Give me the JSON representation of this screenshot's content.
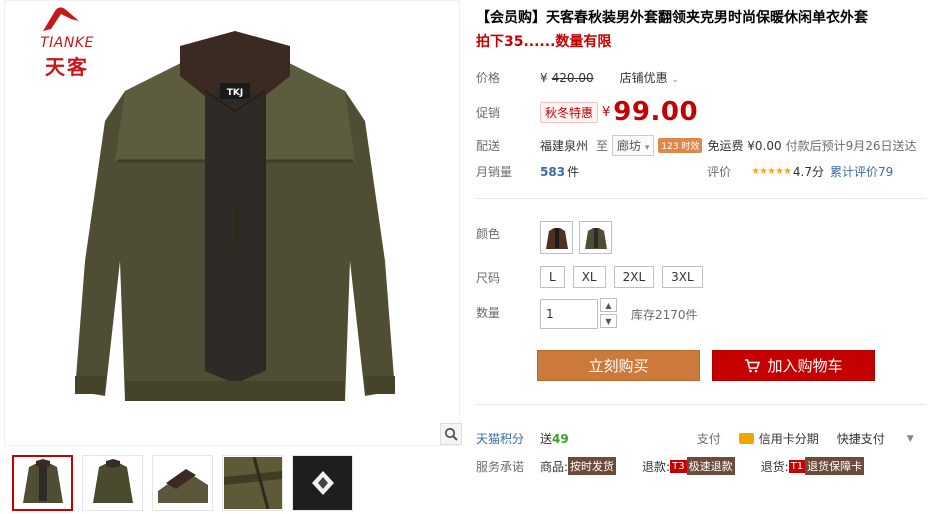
{
  "brand": {
    "name_en": "TIANKE",
    "name_cn": "天客"
  },
  "product": {
    "title": "【会员购】天客春秋装男外套翻领夹克男时尚保暖休闲单衣外套",
    "subtitle": "拍下35......数量有限",
    "label_tag": "TKJ"
  },
  "price": {
    "label": "价格",
    "currency": "¥",
    "original": "420.00",
    "shop_promo": "店铺优惠"
  },
  "promo": {
    "label": "促销",
    "tag": "秋冬特惠",
    "currency": "¥",
    "value": "99.00"
  },
  "shipping": {
    "label": "配送",
    "origin": "福建泉州",
    "to": "至",
    "destination": "廊坊",
    "hours_badge": "123 时效",
    "fee": "免运费 ¥0.00",
    "estimate": "付款后预计9月26日送达"
  },
  "sales": {
    "label": "月销量",
    "count": "583",
    "unit": "件",
    "rating_label": "评价",
    "stars": "★★★★★",
    "score": "4.7分",
    "reviews": "累计评价79"
  },
  "options": {
    "color_label": "颜色",
    "size_label": "尺码",
    "sizes": [
      "L",
      "XL",
      "2XL",
      "3XL"
    ],
    "qty_label": "数量",
    "qty_value": "1",
    "stock": "库存2170件"
  },
  "actions": {
    "buy_now": "立刻购买",
    "add_cart": "加入购物车"
  },
  "points": {
    "label": "天猫积分",
    "value_prefix": "送",
    "value": "49",
    "pay_label": "支付",
    "card": "信用卡分期",
    "quick_pay": "快捷支付"
  },
  "service": {
    "label": "服务承诺",
    "goods_label": "商品:",
    "goods_tag": "按时发货",
    "refund_label": "退款:",
    "refund_badge": "T3",
    "refund_tag": "极速退款",
    "return_label": "退货:",
    "return_badge": "T1",
    "return_tag": "退货保障卡"
  },
  "colors": {
    "accent": "#c40000",
    "buy_now": "#cc7a3c",
    "jacket": "#4f4d33",
    "collar": "#3b2a21"
  },
  "icons": [
    "zoom-icon",
    "cart-icon",
    "card-icon",
    "chevron-down-icon",
    "up-arrow-icon",
    "down-arrow-icon"
  ]
}
